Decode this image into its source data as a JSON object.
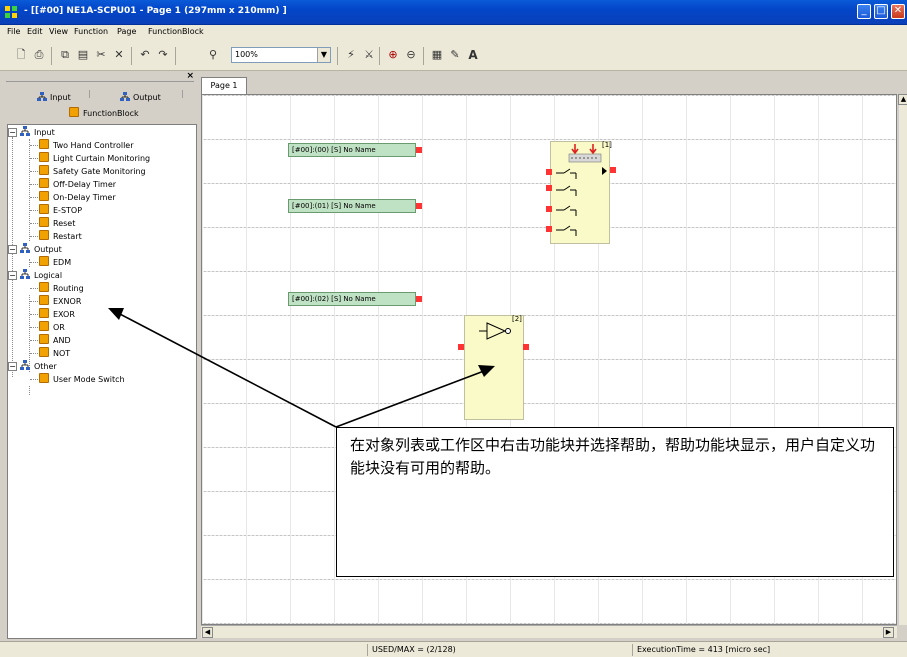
{
  "window": {
    "title": "- [[#00] NE1A-SCPU01 - Page 1 (297mm x 210mm) ]"
  },
  "menu": [
    "File",
    "Edit",
    "View",
    "Function",
    "Page",
    "FunctionBlock"
  ],
  "toolbar": {
    "zoom": "100%",
    "text_tool": "A"
  },
  "left_panel": {
    "tabs": {
      "input": "Input",
      "output": "Output",
      "functionblock": "FunctionBlock"
    },
    "tree": [
      {
        "label": "Input",
        "children": [
          "Two Hand Controller",
          "Light Curtain Monitoring",
          "Safety Gate Monitoring",
          "Off-Delay Timer",
          "On-Delay Timer",
          "E-STOP",
          "Reset",
          "Restart"
        ]
      },
      {
        "label": "Output",
        "children": [
          "EDM"
        ]
      },
      {
        "label": "Logical",
        "children": [
          "Routing",
          "EXNOR",
          "EXOR",
          "OR",
          "AND",
          "NOT"
        ]
      },
      {
        "label": "Other",
        "children": [
          "User Mode Switch"
        ]
      }
    ]
  },
  "workspace": {
    "page_tab": "Page 1",
    "inputs": [
      "[#00]:(00) [S] No Name",
      "[#00]:(01) [S] No Name",
      "[#00]:(02) [S] No Name"
    ],
    "blocks": [
      {
        "number": "[1]"
      },
      {
        "number": "[2]"
      }
    ]
  },
  "callout": {
    "text": "在对象列表或工作区中右击功能块并选择帮助，帮助功能块显示，用户自定义功能块没有可用的帮助。"
  },
  "status": {
    "used": "USED/MAX = (2/128)",
    "execution": "ExecutionTime = 413 [micro sec]"
  }
}
